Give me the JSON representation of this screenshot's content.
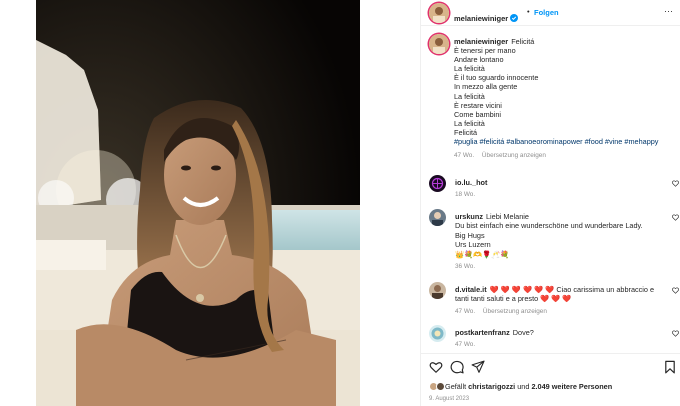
{
  "post": {
    "author": "melaniewiniger",
    "dot": "•",
    "follow_label": "Folgen",
    "more_label": "···",
    "caption_lines": [
      "Felicitá",
      "È tenersi per mano",
      "Andare lontano",
      "La felicità",
      "È il tuo sguardo innocente",
      "In mezzo alla gente",
      "La felicità",
      "È restare vicini",
      "Come bambini",
      "La felicità",
      "Felicitá"
    ],
    "hashtags": "#puglia #felicitá #albanoeorominapower #food #vine #mehappy",
    "caption_age": "47 Wo.",
    "translate_label": "Übersetzung anzeigen"
  },
  "comments": [
    {
      "user": "io.lu._hot",
      "text": "",
      "age": "18 Wo.",
      "translate": ""
    },
    {
      "user": "urskunz",
      "text_lines": [
        "Liebi Melanie",
        "Du bist einfach eine wunderschöne und wunderbare Lady.",
        "Big Hugs",
        "Urs Luzern"
      ],
      "emoji": "👑💐🫶🌹🥂💐",
      "age": "36 Wo."
    },
    {
      "user": "d.vitale.it",
      "hearts_before": "❤️ ❤️ ❤️ ❤️ ❤️ ❤️",
      "text": "Ciao carissima un abbraccio e tanti tanti saluti e a presto",
      "hearts_after": "❤️ ❤️ ❤️",
      "age": "47 Wo.",
      "translate": "Übersetzung anzeigen"
    },
    {
      "user": "postkartenfranz",
      "text": "Dove?",
      "age": "47 Wo."
    }
  ],
  "footer": {
    "liked_prefix": "Gefällt",
    "liked_user": "christarigozzi",
    "liked_mid": "und",
    "liked_count": "2.049 weitere Personen",
    "date": "9. August 2023"
  },
  "colors": {
    "accent": "#0095f6",
    "heart": "#ed4956",
    "hashtag": "#00376b",
    "muted": "#8e8e8e"
  },
  "icons": [
    "verified-badge-icon",
    "more-options-icon",
    "like-heart-icon",
    "comment-icon",
    "share-icon",
    "save-bookmark-icon"
  ]
}
